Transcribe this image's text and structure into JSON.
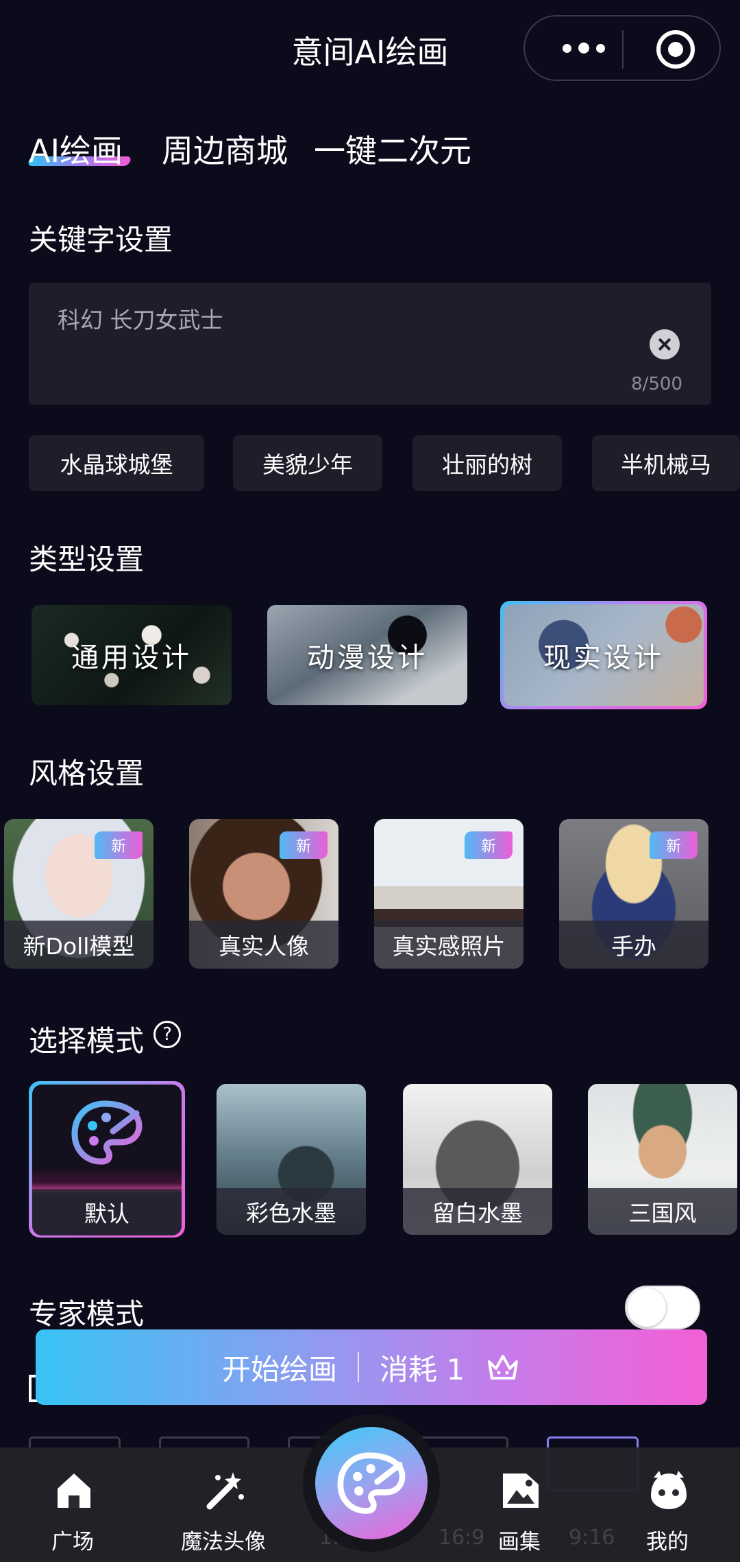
{
  "header": {
    "title": "意间AI绘画"
  },
  "tabs": [
    "AI绘画",
    "周边商城",
    "一键二次元"
  ],
  "keyword": {
    "section_title": "关键字设置",
    "value": "科幻 长刀女武士",
    "count": "8/500",
    "chips": [
      "水晶球城堡",
      "美貌少年",
      "壮丽的树",
      "半机械马"
    ]
  },
  "type": {
    "section_title": "类型设置",
    "cards": [
      "通用设计",
      "动漫设计",
      "现实设计"
    ],
    "selected": "现实设计"
  },
  "style": {
    "section_title": "风格设置",
    "badge": "新",
    "cards": [
      "新Doll模型",
      "真实人像",
      "真实感照片",
      "手办"
    ]
  },
  "mode": {
    "section_title": "选择模式",
    "help": "?",
    "cards": [
      "默认",
      "彩色水墨",
      "留白水墨",
      "三国风"
    ],
    "selected": "默认"
  },
  "expert": {
    "label": "专家模式",
    "enabled": false
  },
  "start_button": {
    "label": "开始绘画",
    "cost": "消耗 1"
  },
  "below_fold": {
    "ratio_a": "1:1",
    "ratio_b": "16:9",
    "ratio_c": "9:16"
  },
  "nav": {
    "items": [
      "广场",
      "魔法头像",
      "画集",
      "我的"
    ]
  },
  "colors": {
    "background": "#0c0b1b",
    "accent_start": "#37c4f4",
    "accent_end": "#f45fd6"
  }
}
